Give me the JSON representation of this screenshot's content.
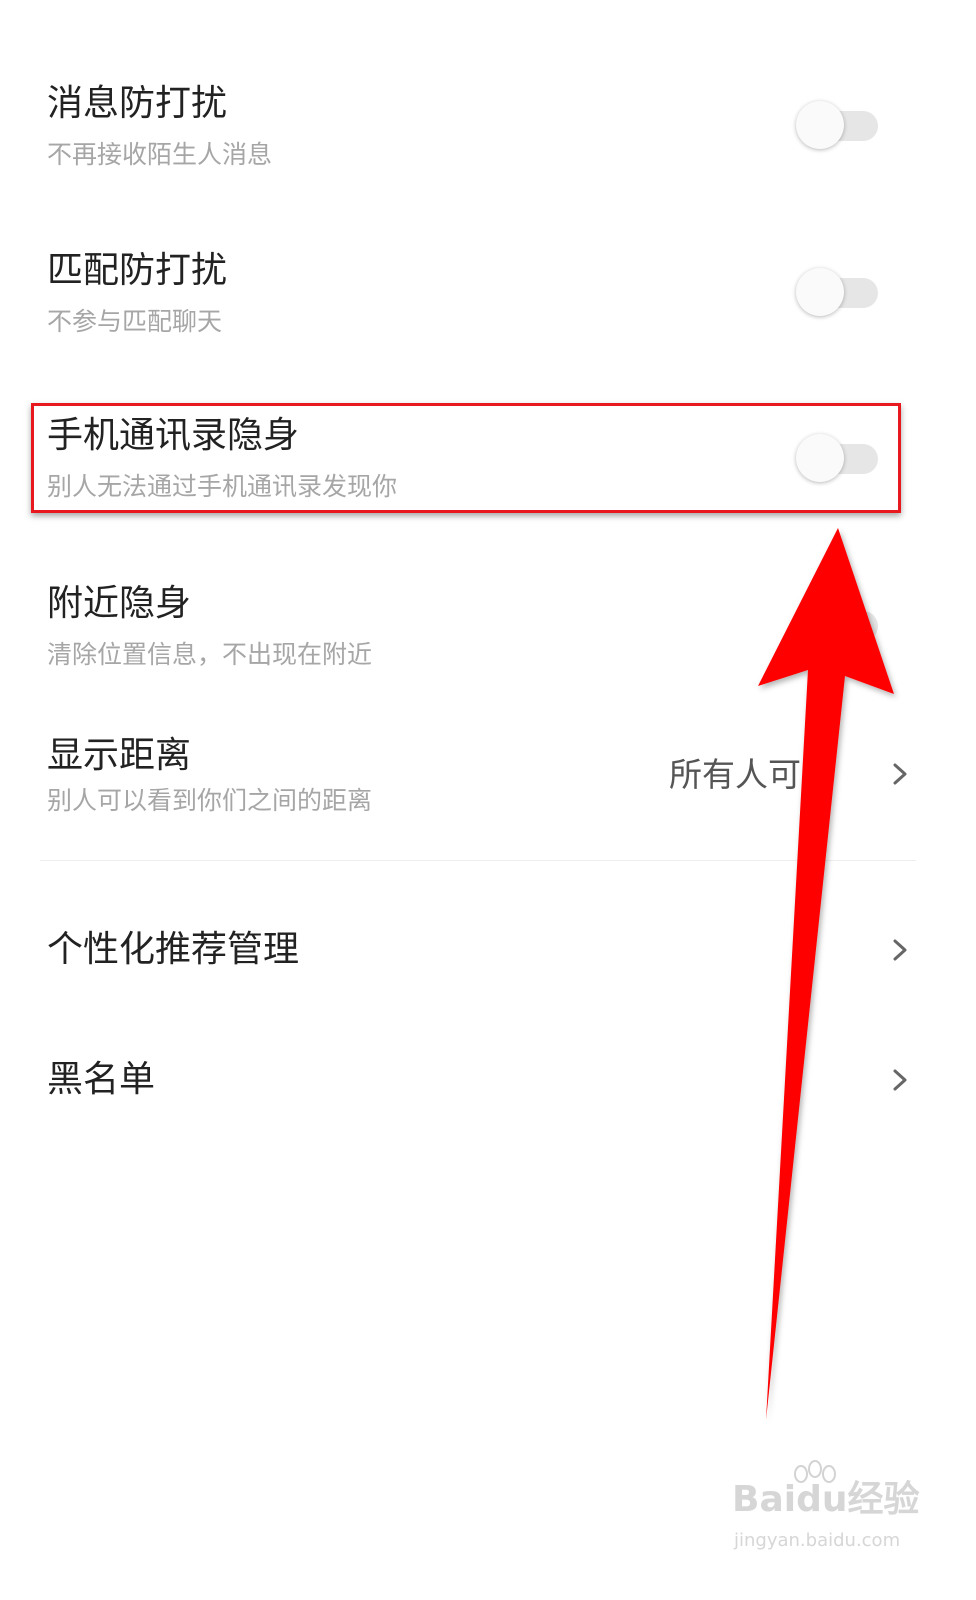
{
  "settings": [
    {
      "title": "消息防打扰",
      "subtitle": "不再接收陌生人消息",
      "control": "toggle",
      "enabled": false
    },
    {
      "title": "匹配防打扰",
      "subtitle": "不参与匹配聊天",
      "control": "toggle",
      "enabled": false
    },
    {
      "title": "手机通讯录隐身",
      "subtitle": "别人无法通过手机通讯录发现你",
      "control": "toggle",
      "enabled": false,
      "highlighted": true
    },
    {
      "title": "附近隐身",
      "subtitle": "清除位置信息，不出现在附近",
      "control": "toggle",
      "enabled": false
    },
    {
      "title": "显示距离",
      "subtitle": "别人可以看到你们之间的距离",
      "control": "select",
      "value": "所有人可见"
    },
    {
      "title": "个性化推荐管理",
      "control": "link"
    },
    {
      "title": "黑名单",
      "control": "link"
    }
  ],
  "annotation": {
    "highlight_color": "#e8181f",
    "arrow_color": "#ff0000"
  },
  "watermark": {
    "logo": "Baidu经验",
    "url": "jingyan.baidu.com"
  }
}
